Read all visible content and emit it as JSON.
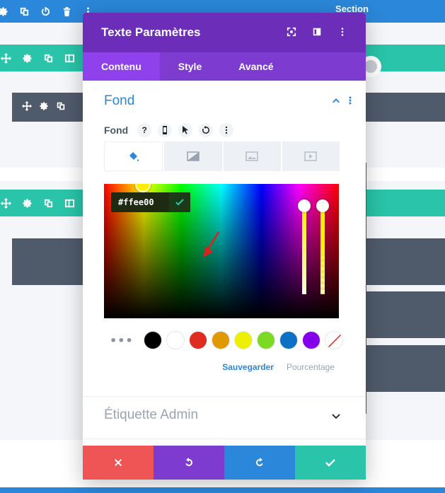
{
  "builder": {
    "section_label": "Section"
  },
  "modal": {
    "title": "Texte Paramètres",
    "tabs": [
      {
        "label": "Contenu",
        "active": true
      },
      {
        "label": "Style",
        "active": false
      },
      {
        "label": "Avancé",
        "active": false
      }
    ],
    "group": {
      "title": "Fond",
      "field_label": "Fond",
      "help_label": "?",
      "bg_tabs": [
        "color",
        "gradient",
        "image",
        "video"
      ],
      "color_picker": {
        "hex_value": "#ffee00",
        "selected_color": "#ffee00"
      },
      "swatches": [
        {
          "name": "black",
          "color": "#000000"
        },
        {
          "name": "white",
          "color": "#ffffff"
        },
        {
          "name": "red",
          "color": "#e02b20"
        },
        {
          "name": "orange",
          "color": "#e09900"
        },
        {
          "name": "yellow",
          "color": "#edf000"
        },
        {
          "name": "green",
          "color": "#7cda24"
        },
        {
          "name": "blue",
          "color": "#0c71c3"
        },
        {
          "name": "purple",
          "color": "#8300e9"
        },
        {
          "name": "none",
          "color": "transparent"
        }
      ],
      "more_label": "•••",
      "save_label": "Sauvegarder",
      "percent_label": "Pourcentage"
    },
    "admin_label_title": "Étiquette Admin",
    "footer_colors": {
      "cancel": "#ef5555",
      "undo": "#7e3bd0",
      "redo": "#2b87da",
      "save": "#29c4a9"
    }
  },
  "colors": {
    "builder_blue": "#2b87da",
    "builder_teal": "#29c4a9",
    "header_purple": "#6c2eb9",
    "tabs_purple": "#7e3bd0",
    "active_tab": "#8f42ec",
    "dark_block": "#4f5a6b"
  }
}
